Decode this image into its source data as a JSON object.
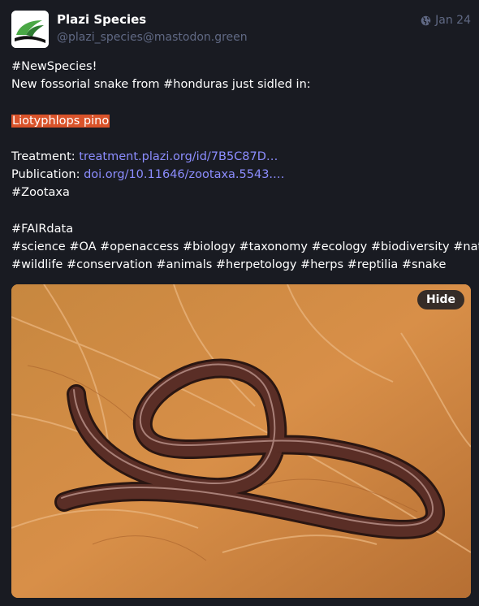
{
  "account": {
    "display_name": "Plazi Species",
    "handle": "@plazi_species@mastodon.green"
  },
  "meta": {
    "visibility_icon": "globe-icon",
    "date": "Jan 24"
  },
  "post": {
    "line1": "#NewSpecies!",
    "line2_prefix": "New fossorial snake from ",
    "line2_tag": "#honduras",
    "line2_suffix": " just sidled in:",
    "species_name": "Liotyphlops pino",
    "treatment_label": "Treatment: ",
    "treatment_link": "treatment.plazi.org/id/7B5C87D…",
    "publication_label": "Publication: ",
    "publication_link": "doi.org/10.11646/zootaxa.5543.…",
    "tag_zootaxa": "#Zootaxa",
    "tag_fairdata": "#FAIRdata",
    "tags_line1": "#science #OA #openaccess #biology #taxonomy #ecology #biodiversity #nature",
    "tags_line2": "#wildlife #conservation #animals #herpetology #herps #reptilia #snake"
  },
  "media": {
    "hide_label": "Hide"
  },
  "colors": {
    "background": "#191b22",
    "muted_text": "#606984",
    "link": "#8c8dff",
    "highlight": "#d9532a"
  }
}
